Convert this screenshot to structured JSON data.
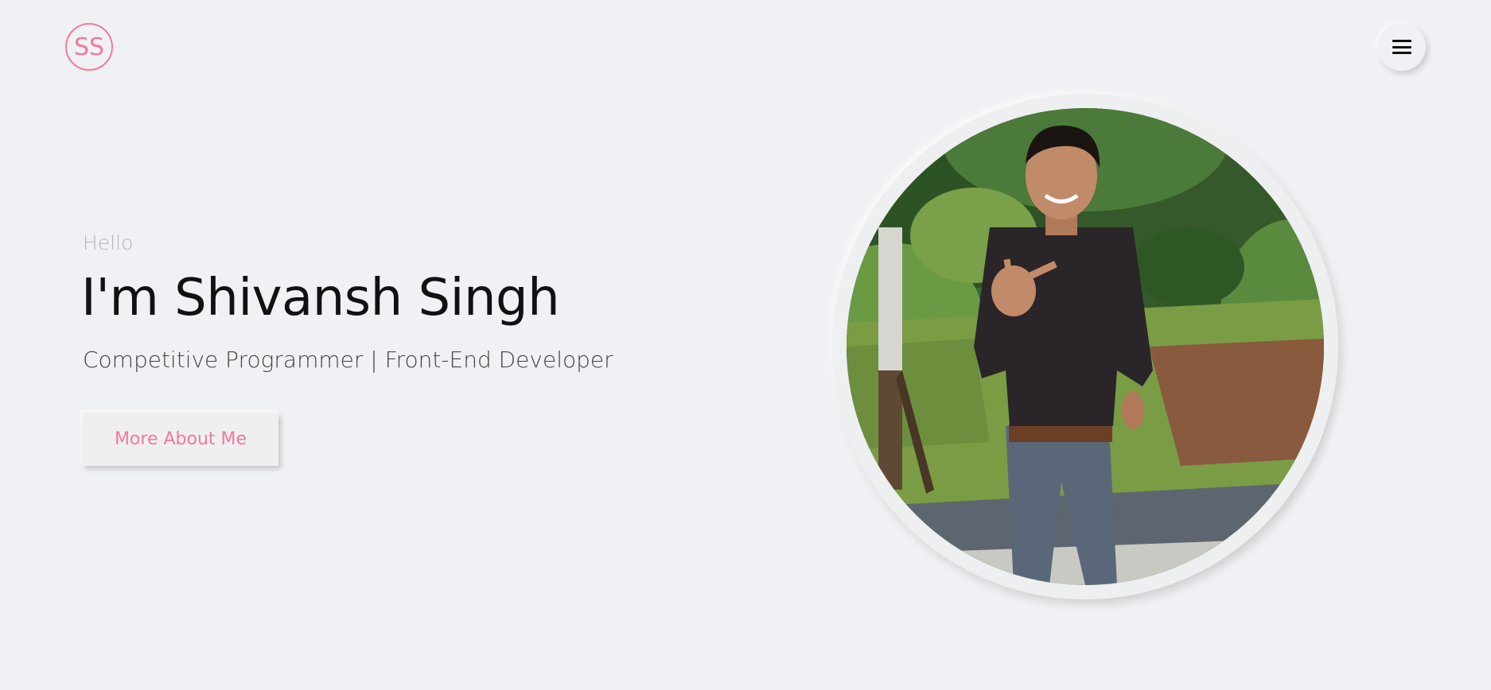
{
  "header": {
    "logo_text": "SS",
    "menu_icon": "hamburger-menu-icon"
  },
  "hero": {
    "greeting": "Hello",
    "name": "I'm Shivansh Singh",
    "role": "Competitive Programmer | Front-End Developer",
    "cta_label": "More About Me"
  },
  "colors": {
    "accent": "#f07a9c",
    "background": "#f0f1f4",
    "heading": "#111111",
    "muted": "#b7b7b9"
  }
}
